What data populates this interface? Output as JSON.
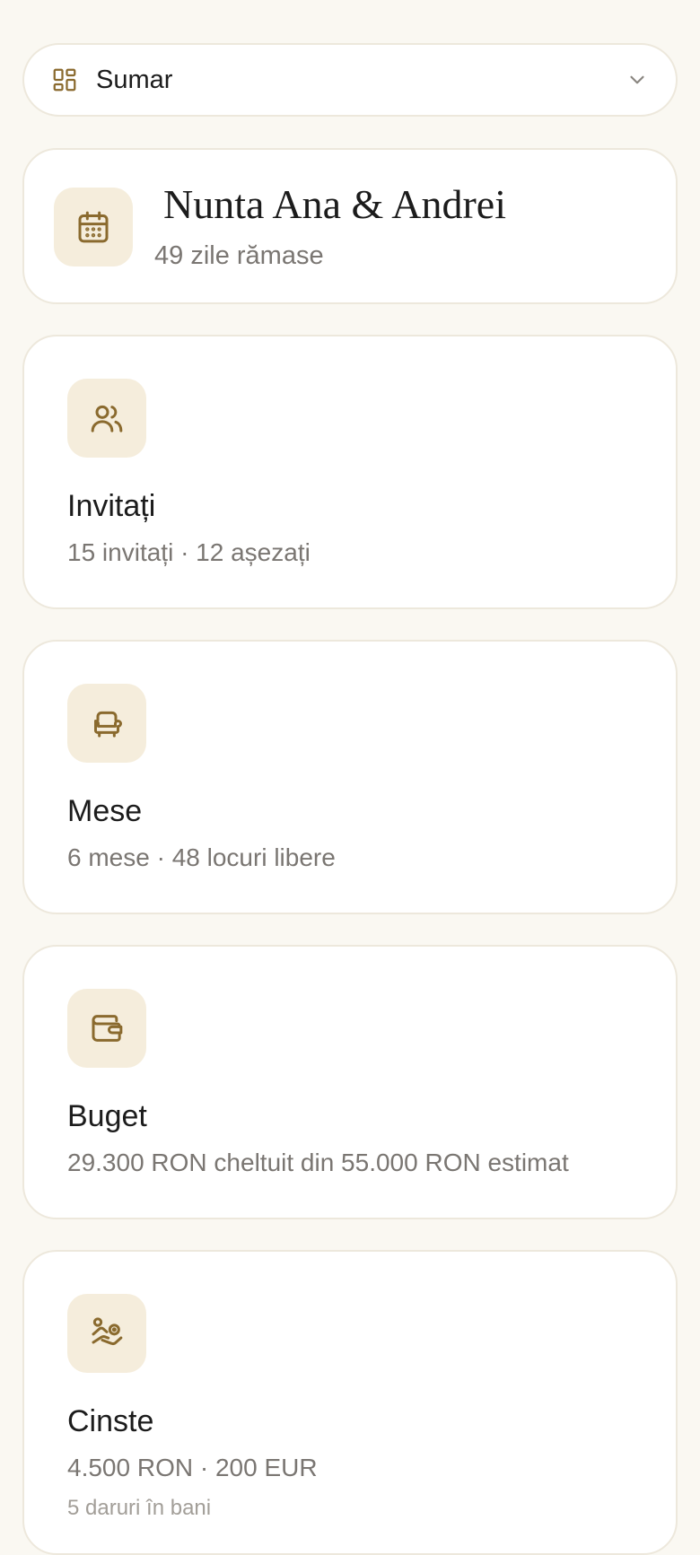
{
  "colors": {
    "background": "#FAF8F2",
    "card": "#FFFFFF",
    "border": "#EDE8DC",
    "icon_tile": "#F5EDDC",
    "icon_stroke": "#8A6A2E",
    "muted_text": "#7A7672"
  },
  "selector": {
    "icon": "layout-grid-icon",
    "label": "Sumar",
    "chevron_icon": "chevron-down-icon"
  },
  "event": {
    "icon": "calendar-icon",
    "title": "Nunta Ana & Andrei",
    "subtitle": "49 zile rămase"
  },
  "cards": [
    {
      "icon": "users-icon",
      "title": "Invitați",
      "subtitle": "15 invitați · 12 așezați"
    },
    {
      "icon": "armchair-icon",
      "title": "Mese",
      "subtitle": "6 mese · 48 locuri libere"
    },
    {
      "icon": "wallet-icon",
      "title": "Buget",
      "subtitle": "29.300 RON cheltuit din 55.000 RON estimat"
    },
    {
      "icon": "hand-coins-icon",
      "title": "Cinste",
      "subtitle": "4.500 RON · 200 EUR",
      "detail": "5 daruri în bani"
    }
  ]
}
